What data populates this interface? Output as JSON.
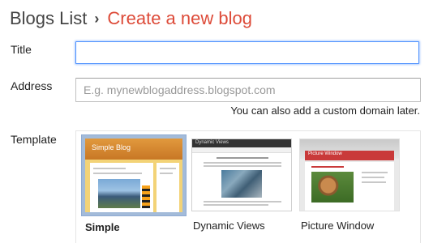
{
  "breadcrumb": {
    "root": "Blogs List",
    "separator": "›",
    "current": "Create a new blog"
  },
  "form": {
    "title_label": "Title",
    "title_value": "",
    "address_label": "Address",
    "address_value": "",
    "address_placeholder": "E.g. mynewblogaddress.blogspot.com",
    "address_hint": "You can also add a custom domain later.",
    "template_label": "Template"
  },
  "templates": [
    {
      "name": "Simple",
      "selected": true,
      "preview_title": "Simple Blog"
    },
    {
      "name": "Dynamic Views",
      "selected": false,
      "preview_title": "Dynamic Views"
    },
    {
      "name": "Picture Window",
      "selected": false,
      "preview_title": "Picture Window"
    }
  ],
  "colors": {
    "accent": "#dd4b39",
    "focus_border": "#4d90fe",
    "selected_border": "#a3bbd9"
  }
}
